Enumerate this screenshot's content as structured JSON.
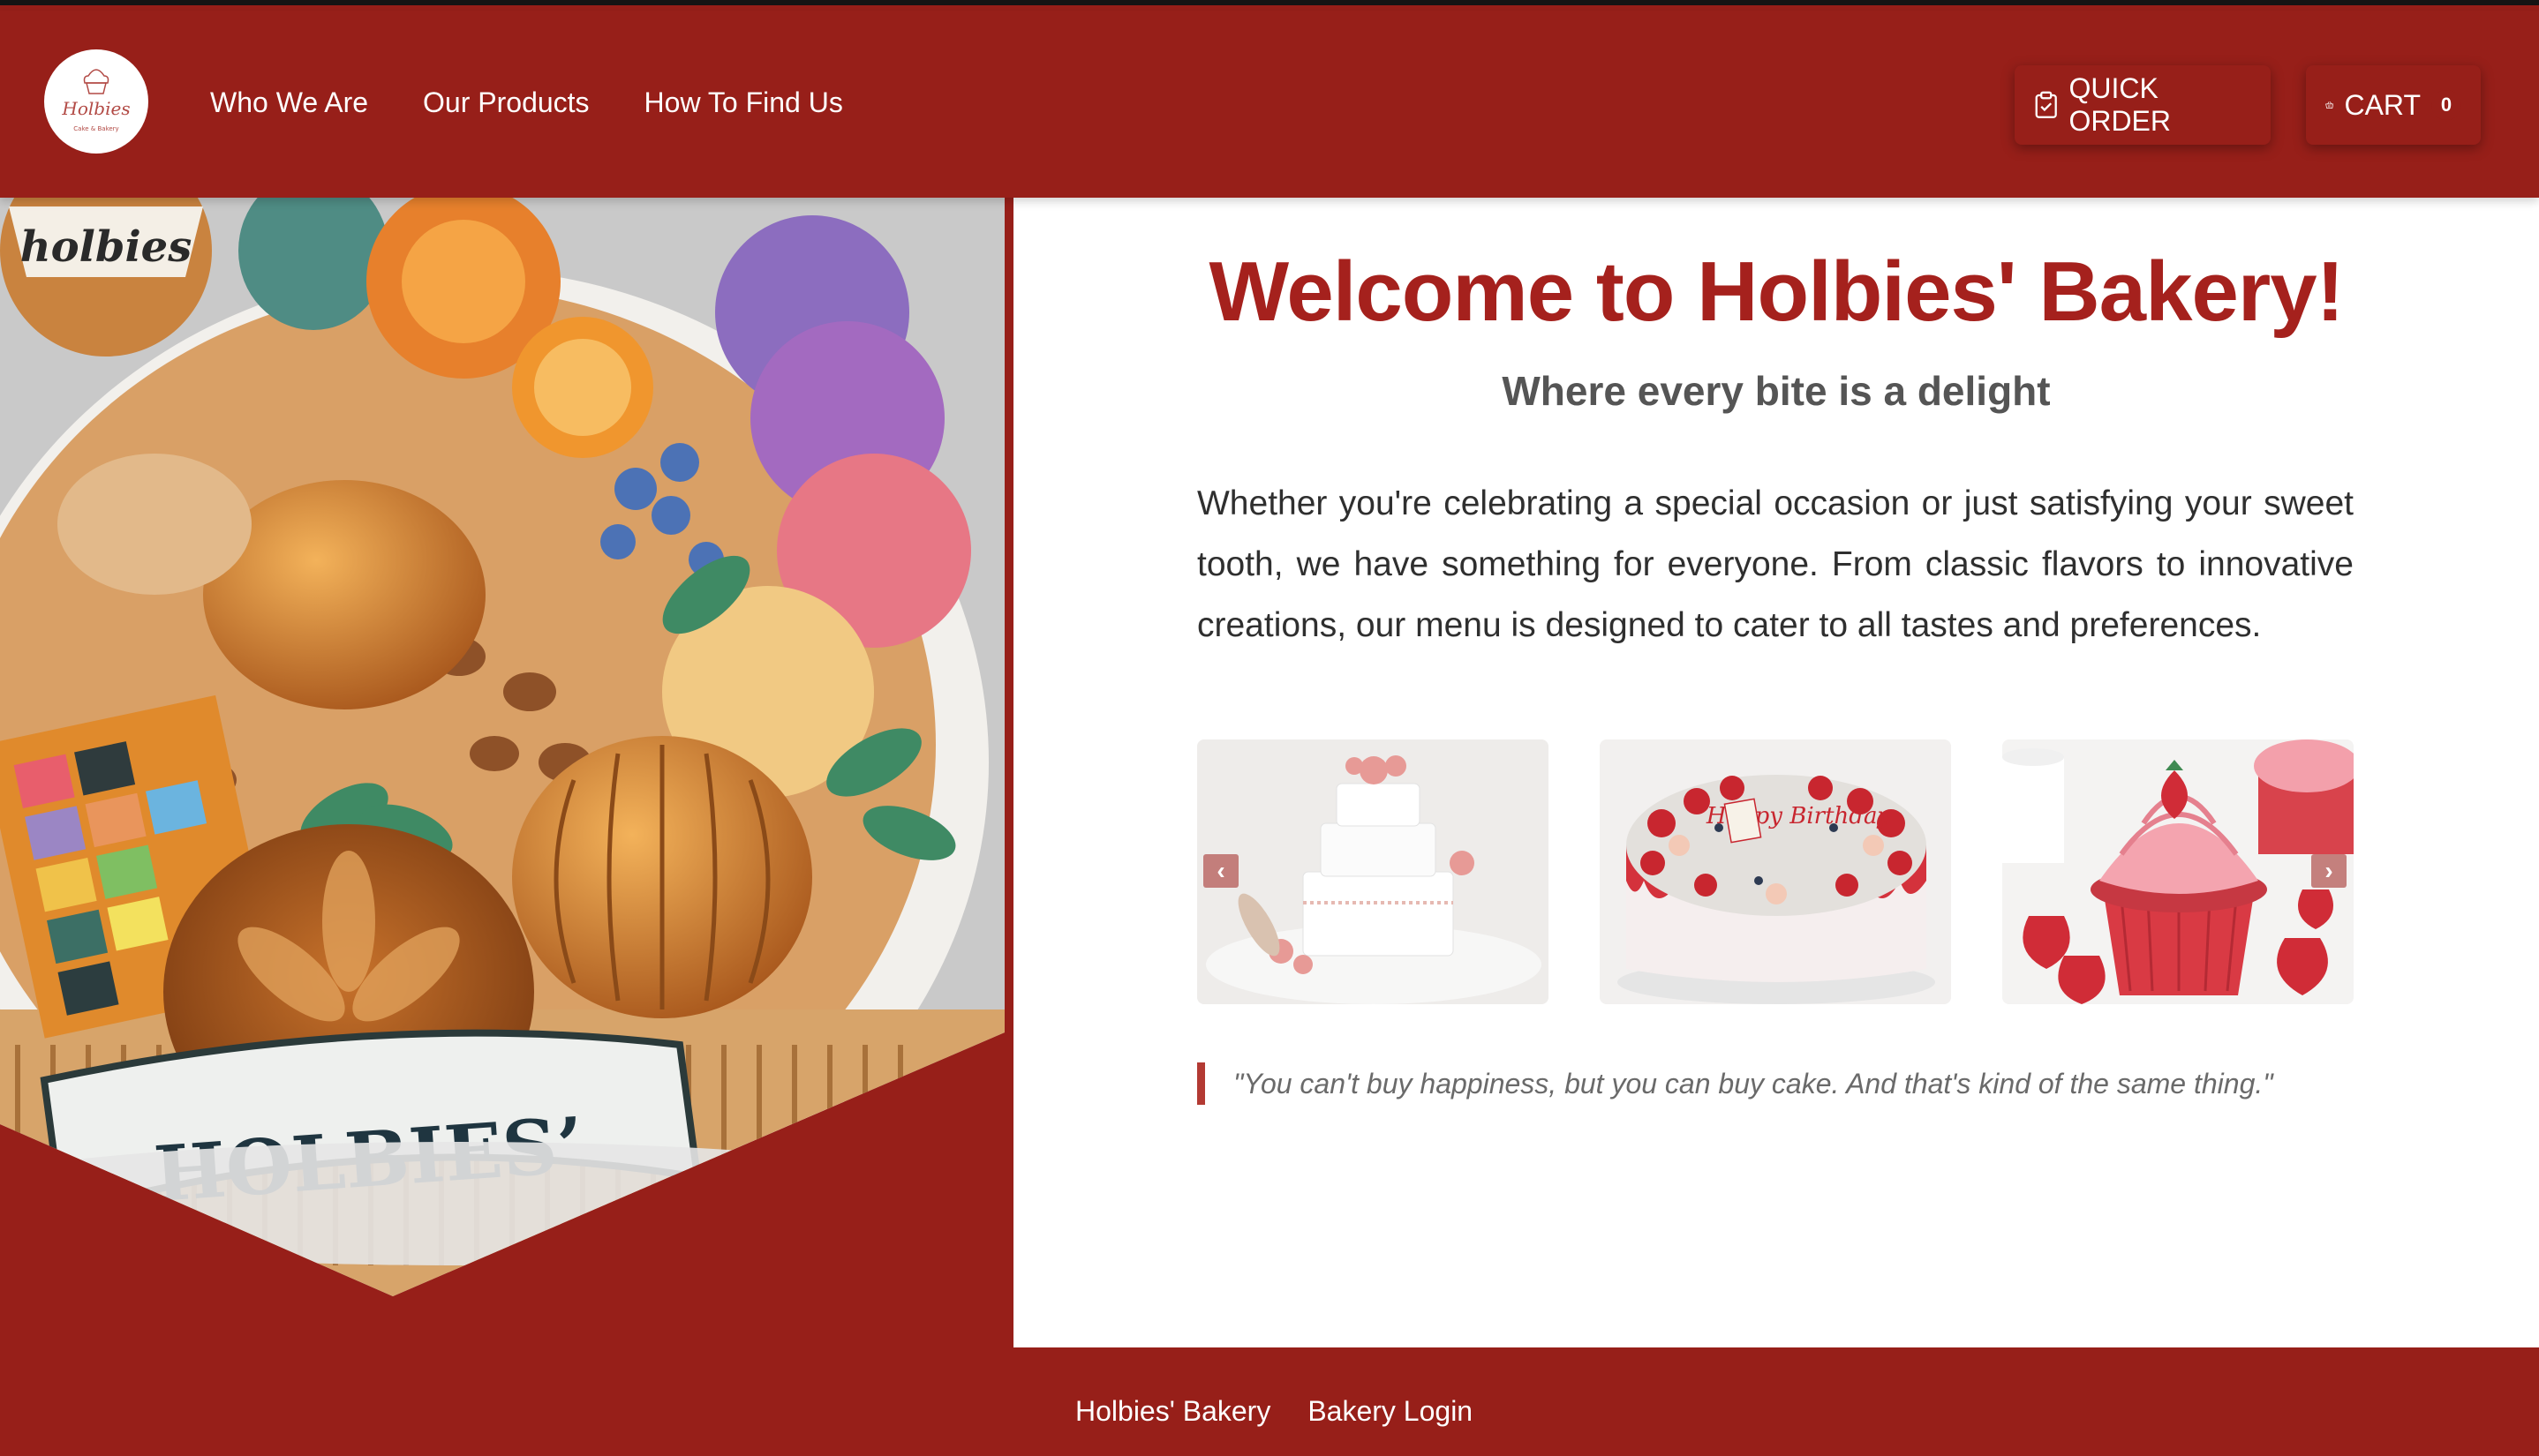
{
  "header": {
    "logo_script": "Holbies",
    "logo_tagline": "Cake & Bakery",
    "nav": [
      {
        "label": "Who We Are"
      },
      {
        "label": "Our Products"
      },
      {
        "label": "How To Find Us"
      }
    ],
    "quick_order_label": "QUICK ORDER",
    "cart_label": "CART",
    "cart_count": "0"
  },
  "hero": {
    "cake_topper_text": "holbies",
    "banner_text": "HOLBIES’"
  },
  "main": {
    "title": "Welcome to Holbies' Bakery!",
    "subtitle": "Where every bite is a delight",
    "intro": "Whether you're celebrating a special occasion or just satisfying your sweet tooth, we have something for everyone. From classic flavors to innovative creations, our menu is designed to cater to all tastes and preferences.",
    "carousel": {
      "prev_symbol": "‹",
      "next_symbol": "›",
      "slides": [
        {
          "subject": "wedding-cake"
        },
        {
          "subject": "birthday-cake",
          "cake_text": "Happy Birthday"
        },
        {
          "subject": "red-velvet-cupcake"
        }
      ]
    },
    "quote": "\"You can't buy happiness, but you can buy cake. And that's kind of the same thing.\""
  },
  "footer": {
    "links": [
      {
        "label": "Holbies' Bakery"
      },
      {
        "label": "Bakery Login"
      }
    ]
  },
  "colors": {
    "brand_red": "#971f19",
    "title_red": "#a5211d",
    "quote_bar": "#b33a33",
    "panel_bg": "#ffffff"
  }
}
